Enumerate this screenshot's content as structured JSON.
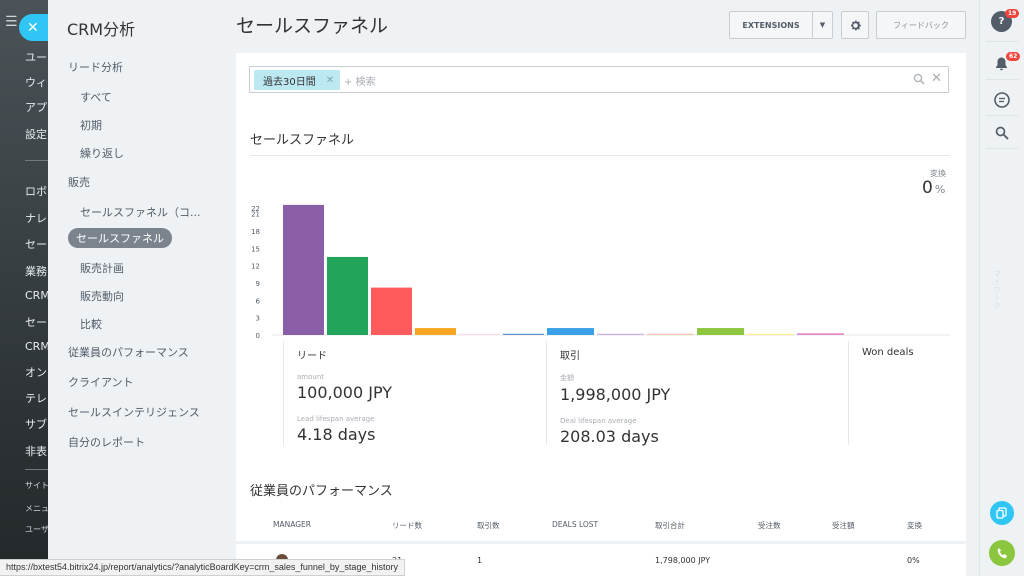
{
  "left_nav": {
    "items": [
      "ユー",
      "ウィ",
      "アプ",
      "設定",
      "ロボ",
      "ナレ",
      "セー",
      "業務",
      "CRM",
      "セー",
      "CRM",
      "オン",
      "テレ",
      "サブ",
      "非表"
    ],
    "bottom_items": [
      "サイト",
      "メニュ",
      "ユーザ"
    ]
  },
  "menu": {
    "title": "CRM分析",
    "items": [
      {
        "label": "リード分析",
        "level": 0
      },
      {
        "label": "すべて",
        "level": 1
      },
      {
        "label": "初期",
        "level": 1
      },
      {
        "label": "繰り返し",
        "level": 1
      },
      {
        "label": "販売",
        "level": 0
      },
      {
        "label": "セールスファネル（コ...",
        "level": 1
      },
      {
        "label": "セールスファネル",
        "level": 1,
        "active": true
      },
      {
        "label": "販売計画",
        "level": 1
      },
      {
        "label": "販売動向",
        "level": 1
      },
      {
        "label": "比較",
        "level": 1
      },
      {
        "label": "従業員のパフォーマンス",
        "level": 0
      },
      {
        "label": "クライアント",
        "level": 0
      },
      {
        "label": "セールスインテリジェンス",
        "level": 0
      },
      {
        "label": "自分のレポート",
        "level": 0
      }
    ]
  },
  "header": {
    "title": "セールスファネル",
    "extensions_label": "EXTENSIONS",
    "feedback_label": "フィードバック"
  },
  "filter": {
    "chip": "過去30日間",
    "placeholder": "+ 検索"
  },
  "funnel_section": {
    "title": "セールスファネル",
    "conversion_label": "変換",
    "conversion_value": "0",
    "conversion_unit": "%"
  },
  "chart_data": {
    "type": "bar",
    "yticks": [
      0,
      3,
      6,
      9,
      12,
      15,
      18,
      21,
      22
    ],
    "ylim": [
      0,
      23
    ],
    "values": [
      22.5,
      13.5,
      8.2,
      1.2,
      0.15,
      0.2,
      1.2,
      0.2,
      0.2,
      1.2,
      0.2,
      0.3
    ],
    "colors": [
      "#8a5fa8",
      "#22a45b",
      "#ff5b5c",
      "#f5a623",
      "#fddde3",
      "#5f93c6",
      "#3ba1e6",
      "#c9b1ea",
      "#f6c6a9",
      "#8dc63f",
      "#ffef8a",
      "#e68cc9"
    ],
    "widths": [
      41,
      41,
      41,
      41,
      41,
      41,
      47,
      47,
      47,
      47,
      47,
      47
    ]
  },
  "kpis": [
    {
      "heading": "リード",
      "sub1": "amount",
      "val1": "100,000 JPY",
      "sub2": "Lead lifespan average",
      "val2": "4.18 days"
    },
    {
      "heading": "取引",
      "sub1": "金額",
      "val1": "1,998,000 JPY",
      "sub2": "Deal lifespan average",
      "val2": "208.03 days"
    },
    {
      "heading": "Won deals",
      "sub1": "",
      "val1": "",
      "sub2": "",
      "val2": ""
    }
  ],
  "performance": {
    "title": "従業員のパフォーマンス",
    "columns": [
      "MANAGER",
      "リード数",
      "取引数",
      "DEALS LOST",
      "取引合計",
      "受注数",
      "受注額",
      "変換"
    ],
    "row": [
      "",
      "21",
      "1",
      "",
      "1,798,000 JPY",
      "",
      "",
      "0%"
    ]
  },
  "right_panel": {
    "help_badge": "19",
    "notif_badge": "62",
    "vertical_text": "マイワーク"
  },
  "status_url": "https://bxtest54.bitrix24.jp/report/analytics/?analyticBoardKey=crm_sales_funnel_by_stage_history"
}
